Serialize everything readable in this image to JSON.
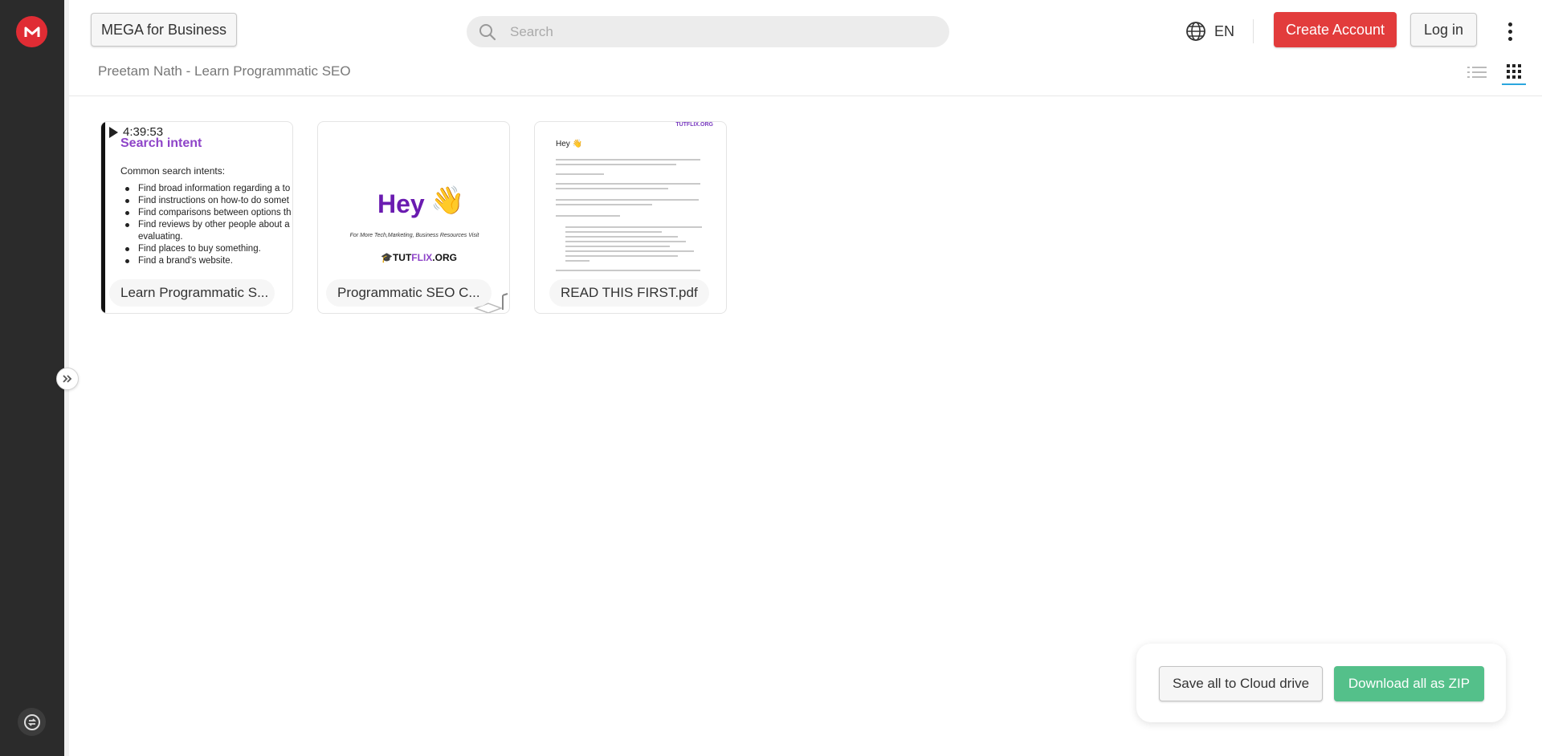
{
  "header": {
    "business_button": "MEGA for Business",
    "search_placeholder": "Search",
    "language": "EN",
    "create_account": "Create Account",
    "log_in": "Log in"
  },
  "breadcrumb": "Preetam Nath - Learn Programmatic SEO",
  "files": [
    {
      "name": "Learn Programmatic S...",
      "type": "video",
      "duration": "4:39:53",
      "thumb": {
        "title": "Search intent",
        "subtitle": "Common search intents:",
        "bullets": [
          "Find broad information regarding a to",
          "Find instructions on how-to do somet",
          "Find comparisons between options th",
          "Find reviews by other people about a",
          "evaluating.",
          "Find places to buy something.",
          "Find a brand's website."
        ]
      }
    },
    {
      "name": "Programmatic SEO C...",
      "type": "image",
      "thumb": {
        "heading": "Hey",
        "resources_line": "For More Tech,Marketing, Business Resources Visit",
        "brand_prefix": "TUT",
        "brand_accent": "FLIX",
        "brand_suffix": ".ORG"
      }
    },
    {
      "name": "READ THIS FIRST.pdf",
      "type": "pdf",
      "thumb": {
        "greeting": "Hey 👋",
        "tag": "TUTFLIX.ORG"
      }
    }
  ],
  "footer": {
    "save_all": "Save all to Cloud drive",
    "download_zip": "Download all as ZIP"
  },
  "colors": {
    "brand_red": "#e02c34",
    "create_red": "#e23c3c",
    "download_green": "#54c08a",
    "rail": "#2b2b2b",
    "accent_blue": "#2ba6de"
  }
}
